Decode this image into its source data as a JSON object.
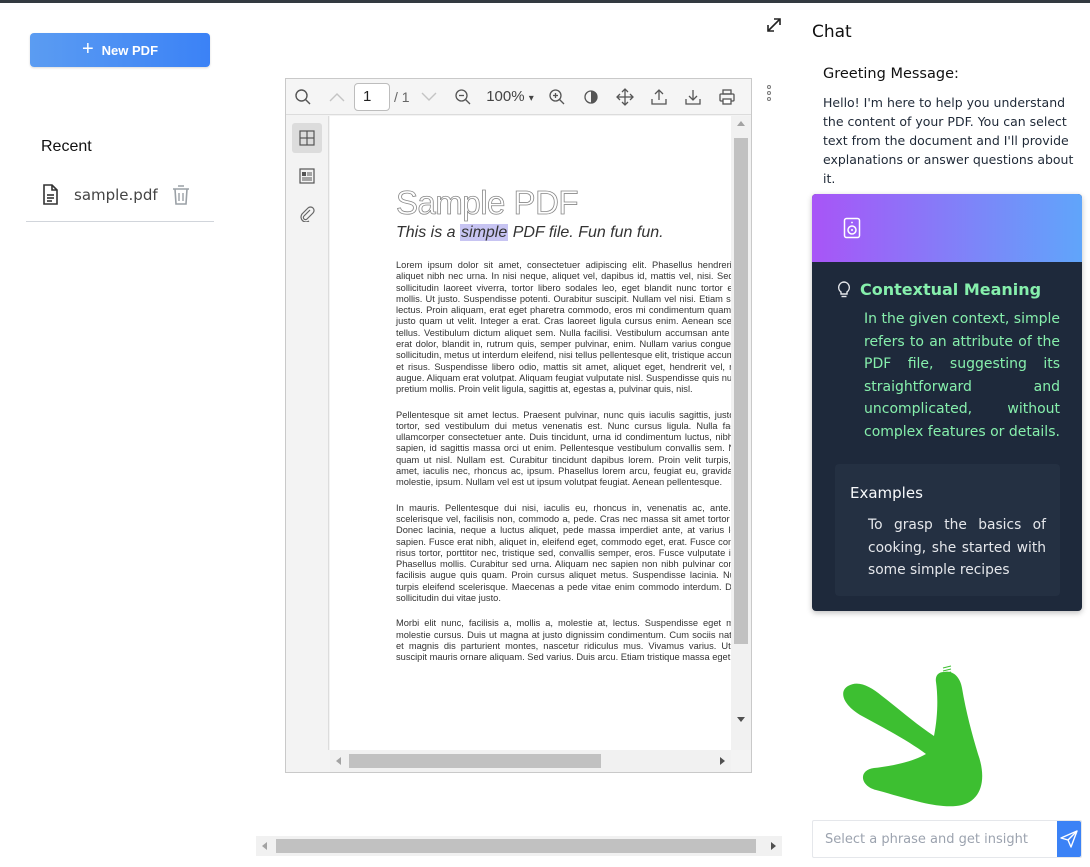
{
  "sidebar": {
    "new_pdf_label": "New PDF",
    "recent_title": "Recent",
    "recent_items": [
      {
        "name": "sample.pdf"
      }
    ]
  },
  "viewer": {
    "toolbar": {
      "page_number": "1",
      "page_total": "/ 1",
      "zoom_label": "100%"
    },
    "document": {
      "title": "Sample PDF",
      "subtitle_before": "This is a ",
      "subtitle_highlight": "simple",
      "subtitle_after": " PDF file. Fun fun fun.",
      "paragraphs": [
        "Lorem ipsum dolor sit amet, consectetuer adipiscing elit. Phasellus hendrerit. Pellentesque aliquet nibh nec urna. In nisi neque, aliquet vel, dapibus id, mattis vel, nisi. Sed pretium, ligula sollicitudin laoreet viverra, tortor libero sodales leo, eget blandit nunc tortor eu nibh. Nullam mollis. Ut justo. Suspendisse potenti. Ourabitur suscipit. Nullam vel nisi. Etiam semper ipsum ut lectus. Proin aliquam, erat eget pharetra commodo, eros mi condimentum quam, sed commodo justo quam ut velit. Integer a erat. Cras laoreet ligula cursus enim. Aenean scelerisque velit et tellus. Vestibulum dictum aliquet sem. Nulla facilisi. Vestibulum accumsan ante vitae elit. Nulla erat dolor, blandit in, rutrum quis, semper pulvinar, enim. Nullam varius congue risus. Vivamus sollicitudin, metus ut interdum eleifend, nisi tellus pellentesque elit, tristique accumsan eros quam et risus. Suspendisse libero odio, mattis sit amet, aliquet eget, hendrerit vel, nulla. Sed vitae augue. Aliquam erat volutpat. Aliquam feugiat vulputate nisl. Suspendisse quis nulla pretium ante pretium mollis. Proin velit ligula, sagittis at, egestas a, pulvinar quis, nisl.",
        "Pellentesque sit amet lectus. Praesent pulvinar, nunc quis iaculis sagittis, justo quam lobortis tortor, sed vestibulum dui metus venenatis est. Nunc cursus ligula. Nulla facilisi. Phasellus ullamcorper consectetuer ante. Duis tincidunt, urna id condimentum luctus, nibh ante vulputate sapien, id sagittis massa orci ut enim. Pellentesque vestibulum convallis sem. Nulla consequat quam ut nisl. Nullam est. Curabitur tincidunt dapibus lorem. Proin velit turpis, scelerisque sit amet, iaculis nec, rhoncus ac, ipsum. Phasellus lorem arcu, feugiat eu, gravida eu, consequat molestie, ipsum. Nullam vel est ut ipsum volutpat feugiat. Aenean pellentesque.",
        "In mauris. Pellentesque dui nisi, iaculis eu, rhoncus in, venenatis ac, ante. Ut odio justo, scelerisque vel, facilisis non, commodo a, pede. Cras nec massa sit amet tortor volutpat varius. Donec lacinia, neque a luctus aliquet, pede massa imperdiet ante, at varius lorem pede sed sapien. Fusce erat nibh, aliquet in, eleifend eget, commodo eget, erat. Fusce consectetuer. Cras risus tortor, porttitor nec, tristique sed, convallis semper, eros. Fusce vulputate ipsum a mauris. Phasellus mollis. Curabitur sed urna. Aliquam nec sapien non nibh pulvinar convallis. Vivamus facilisis augue quis quam. Proin cursus aliquet metus. Suspendisse lacinia. Nulla at tellus ac turpis eleifend scelerisque. Maecenas a pede vitae enim commodo interdum. Donec odio. Sed sollicitudin dui vitae justo.",
        "Morbi elit nunc, facilisis a, mollis a, molestie at, lectus. Suspendisse eget mauris eu tellus molestie cursus. Duis ut magna at justo dignissim condimentum. Cum sociis natoque penatibus et magnis dis parturient montes, nascetur ridiculus mus. Vivamus varius. Ut sit amet diam suscipit mauris ornare aliquam. Sed varius. Duis arcu. Etiam tristique massa eget dui."
      ]
    }
  },
  "chat": {
    "title": "Chat",
    "greeting_title": "Greeting Message:",
    "greeting_text": "Hello! I'm here to help you understand the content of your PDF. You can select text from the document and I'll provide explanations or answer questions about it.",
    "card": {
      "context_title": "Contextual Meaning",
      "context_text": "In the given context, simple refers to an attribute of the PDF file, suggesting its straightforward and uncomplicated, without complex features or details.",
      "examples_title": "Examples",
      "examples_text": "To grasp the basics of cooking, she started with some simple recipes"
    },
    "input_placeholder": "Select a phrase and get insight"
  },
  "colors": {
    "accent_blue": "#3b82f6",
    "card_bg": "#1e293b",
    "context_green": "#86efac",
    "header_gradient_start": "#a855f7",
    "header_gradient_end": "#60a5fa",
    "highlight": "#c7c4f2",
    "hand_green": "#3dbf31"
  },
  "icons": {
    "new_pdf": "plus-icon",
    "recent_file": "file-text-icon",
    "recent_delete": "trash-icon",
    "card_header": "speaker-icon",
    "context": "lightbulb-icon",
    "send": "send-icon",
    "expand": "expand-icon"
  }
}
